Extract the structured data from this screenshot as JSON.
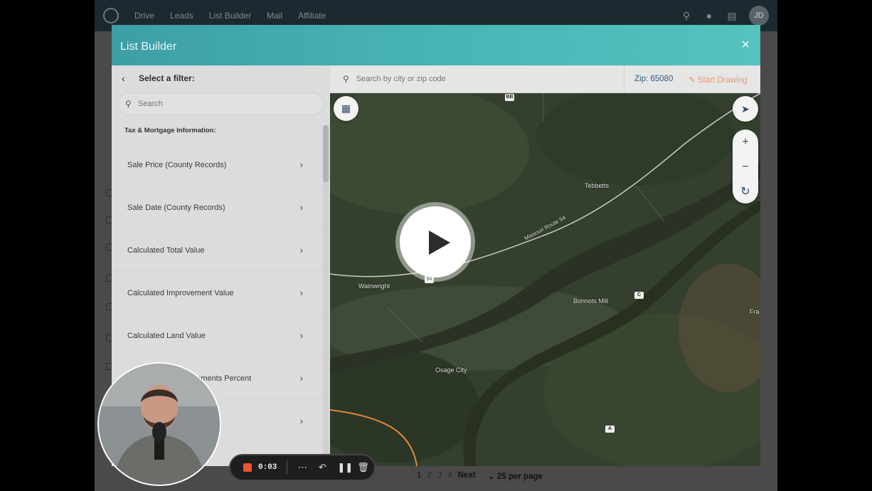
{
  "topnav": {
    "links": [
      "Drive",
      "Leads",
      "List Builder",
      "Mail",
      "Affiliate"
    ],
    "avatar_initials": "JD"
  },
  "modal": {
    "title": "List Builder",
    "close_label": "×"
  },
  "filter_panel": {
    "heading": "Select a filter:",
    "search_placeholder": "Search",
    "section_title": "Tax & Mortgage Information:",
    "items": [
      {
        "label": "Sale Price (County Records)"
      },
      {
        "label": "Sale Date (County Records)"
      },
      {
        "label": "Calculated Total Value"
      },
      {
        "label": "Calculated Improvement Value"
      },
      {
        "label": "Calculated Land Value"
      },
      {
        "label": "...ements Percent"
      },
      {
        "label": ""
      }
    ]
  },
  "map_bar": {
    "search_placeholder": "Search by city or zip code",
    "zip_label": "Zip: 65080",
    "draw_label": "Start Drawing"
  },
  "map": {
    "labels": {
      "tebbetts": "Tebbetts",
      "wainwright": "Wainwright",
      "bonnots_mill": "Bonnots Mill",
      "osage_city": "Osage City",
      "route94": "Missouri Route 94",
      "fra": "Fra"
    },
    "shields": {
      "bb": "BB",
      "r94": "94",
      "c": "C",
      "a": "A"
    }
  },
  "recorder": {
    "time": "0:03"
  },
  "pagination": {
    "pages": [
      "1",
      "2",
      "3",
      "4"
    ],
    "next_label": "Next",
    "per_page": "25 per page"
  },
  "colors": {
    "header_start": "#3d9fa6",
    "header_end": "#55c2bd",
    "zip_color": "#2b5d7c",
    "draw_color": "#e89677",
    "record_color": "#e8572d"
  }
}
